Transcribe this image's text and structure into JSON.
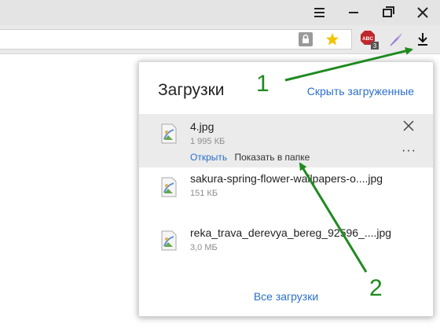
{
  "colors": {
    "accent_link": "#2a6fc9",
    "annotation_green": "#1f8a1f",
    "active_row": "#ebebeb"
  },
  "window_controls": [
    {
      "name": "menu-icon"
    },
    {
      "name": "minimize-icon"
    },
    {
      "name": "restore-icon"
    },
    {
      "name": "close-icon"
    }
  ],
  "toolbar": {
    "icons": [
      "lock-icon",
      "star-icon",
      "adblock-icon",
      "feather-icon",
      "download-icon"
    ],
    "adblock_badge": "ABC",
    "adblock_count": "3"
  },
  "downloads_popup": {
    "title": "Загрузки",
    "hide_completed_label": "Скрыть загруженные",
    "items": [
      {
        "file_name": "4.jpg",
        "size": "1 995 КБ",
        "open_label": "Открыть",
        "show_in_folder_label": "Показать в папке",
        "more_label": "···"
      },
      {
        "file_name": "sakura-spring-flower-wallpapers-o....jpg",
        "size": "151 КБ"
      },
      {
        "file_name": "reka_trava_derevya_bereg_92596_....jpg",
        "size": "3,0 МБ"
      }
    ],
    "all_downloads_label": "Все загрузки"
  },
  "annotations": {
    "label_1": "1",
    "label_2": "2"
  }
}
